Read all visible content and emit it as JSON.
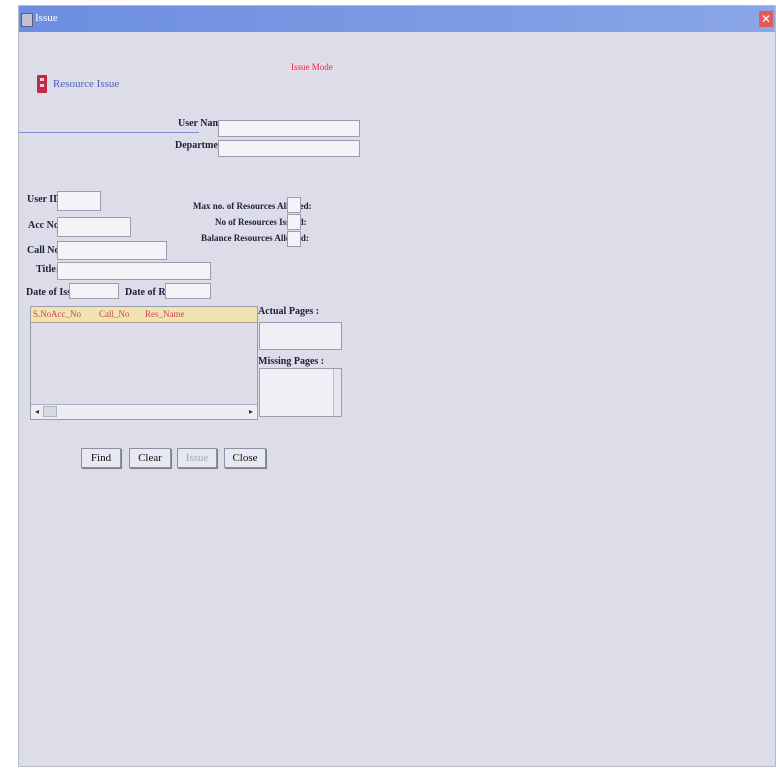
{
  "window": {
    "title": "Issue"
  },
  "header": {
    "form_title": "Resource Issue",
    "mode_label": "Issue Mode"
  },
  "user_section": {
    "user_name_label": "User Name:",
    "department_label": "Department:"
  },
  "resource_section": {
    "user_id_label": "User ID:",
    "acc_no_label": "Acc No.:",
    "call_no_label": "Call No.:",
    "title_label": "Title:",
    "date_of_issue_label": "Date of Issue:",
    "date_of_return_label": "Date of Return:",
    "max_allowed_label": "Max no. of Resources Allowed:",
    "issued_label": "No of Resources Issued:",
    "balance_label": "Balance Resources Allowed:"
  },
  "grid": {
    "columns": [
      "S.No",
      "Acc_No",
      "Call_No",
      "Res_Name"
    ]
  },
  "pages": {
    "actual_pages_label": "Actual Pages :",
    "missing_pages_label": "Missing Pages :"
  },
  "buttons": {
    "find": "Find",
    "clear": "Clear",
    "issue": "Issue",
    "close": "Close"
  }
}
